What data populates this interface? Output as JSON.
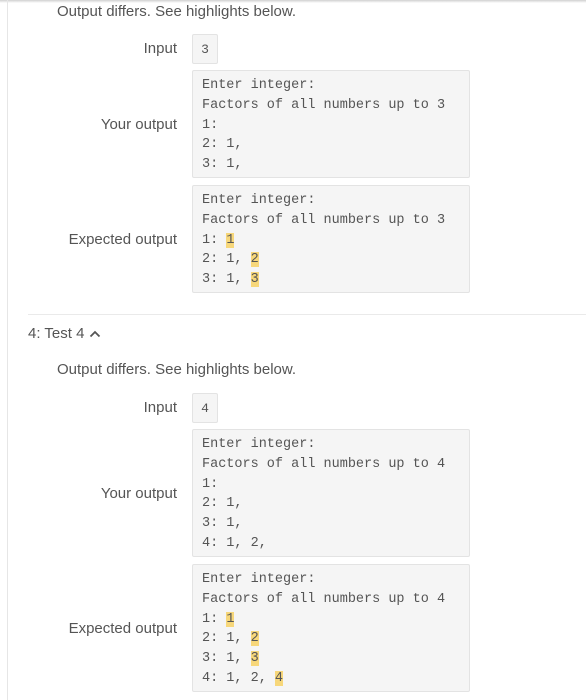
{
  "test3": {
    "message": "Output differs. See highlights below.",
    "input_label": "Input",
    "input_value": "3",
    "your_output_label": "Your output",
    "your_output_lines": [
      {
        "text": "Enter integer:",
        "highlight": ""
      },
      {
        "text": "Factors of all numbers up to 3",
        "highlight": ""
      },
      {
        "text": "1:",
        "highlight": ""
      },
      {
        "text": "2: 1,",
        "highlight": ""
      },
      {
        "text": "3: 1,",
        "highlight": ""
      }
    ],
    "expected_output_label": "Expected output",
    "expected_output_lines": [
      {
        "text": "Enter integer:",
        "highlight": ""
      },
      {
        "text": "Factors of all numbers up to 3",
        "highlight": ""
      },
      {
        "text": "1: ",
        "highlight": "1"
      },
      {
        "text": "2: 1, ",
        "highlight": "2"
      },
      {
        "text": "3: 1, ",
        "highlight": "3"
      }
    ]
  },
  "test4": {
    "header": "4: Test 4",
    "chevron_icon": "chevron-up",
    "message": "Output differs. See highlights below.",
    "input_label": "Input",
    "input_value": "4",
    "your_output_label": "Your output",
    "your_output_lines": [
      {
        "text": "Enter integer:",
        "highlight": ""
      },
      {
        "text": "Factors of all numbers up to 4",
        "highlight": ""
      },
      {
        "text": "1:",
        "highlight": ""
      },
      {
        "text": "2: 1,",
        "highlight": ""
      },
      {
        "text": "3: 1,",
        "highlight": ""
      },
      {
        "text": "4: 1, 2,",
        "highlight": ""
      }
    ],
    "expected_output_label": "Expected output",
    "expected_output_lines": [
      {
        "text": "Enter integer:",
        "highlight": ""
      },
      {
        "text": "Factors of all numbers up to 4",
        "highlight": ""
      },
      {
        "text": "1: ",
        "highlight": "1"
      },
      {
        "text": "2: 1, ",
        "highlight": "2"
      },
      {
        "text": "3: 1, ",
        "highlight": "3"
      },
      {
        "text": "4: 1, 2, ",
        "highlight": "4"
      }
    ]
  },
  "colors": {
    "highlight": "#f7d77a",
    "box_bg": "#f5f5f5",
    "text": "#555555"
  }
}
